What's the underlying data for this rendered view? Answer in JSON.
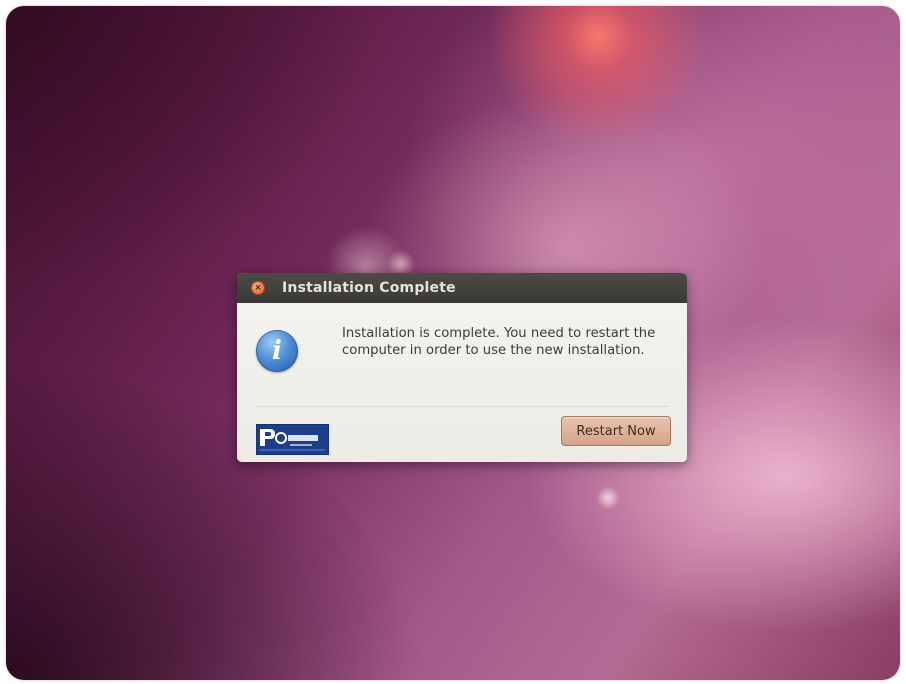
{
  "desktop": {
    "wallpaper": "purple-pink gradient with soft light flares"
  },
  "dialog": {
    "title": "Installation Complete",
    "close_icon": "close-icon",
    "icon": "info-icon",
    "message": "Installation is complete. You need to restart the computer in order to use the new installation.",
    "restart_button_label": "Restart Now",
    "logo": "watermark-logo",
    "colors": {
      "titlebar": "#3b3935",
      "close_button": "#f07746",
      "body_background": "#f2f1ee",
      "button_background": "#d4a488",
      "info_icon": "#4f8fd6"
    }
  }
}
